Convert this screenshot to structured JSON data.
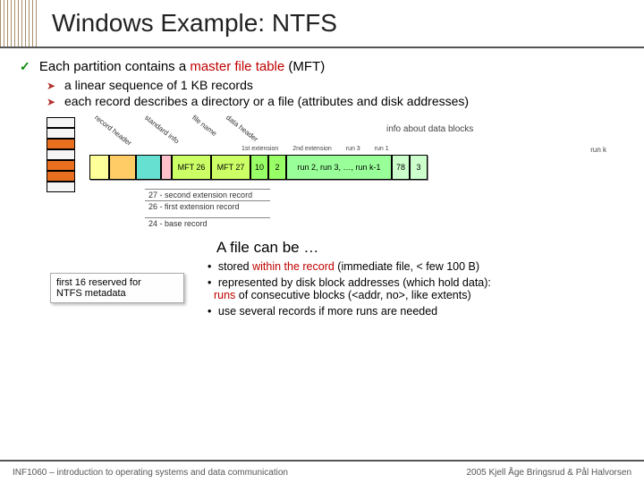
{
  "title": "Windows Example: NTFS",
  "main_bullet": {
    "pre": "Each partition contains a ",
    "red": "master file table",
    "post": " (MFT)"
  },
  "sub_bullets": [
    "a linear sequence of 1 KB records",
    "each record describes a directory or a file (attributes and disk addresses)"
  ],
  "rot_labels": [
    "record header",
    "standard info",
    "file name",
    "data header"
  ],
  "info_label": "info about data blocks",
  "run_header_labels": [
    "1st extension",
    "2nd extension",
    "run 3",
    "run 1"
  ],
  "run_k_label": "run k",
  "record_bar": {
    "mft1": "MFT 26",
    "mft2": "MFT 27",
    "s1": "10",
    "s2": "2",
    "runs": "run 2, run 3, …, run k-1",
    "e1": "78",
    "e2": "3"
  },
  "notes": [
    "27 - second extension record",
    "26 - first extension record",
    "24 - base record"
  ],
  "lower_heading": "A file can be …",
  "lower_bullets": {
    "b1_pre": "stored ",
    "b1_red": "within the record",
    "b1_post": " (immediate file, < few 100 B)",
    "b2_line1": "represented by disk block addresses (which hold data):",
    "b2_line2_red": "runs",
    "b2_line2_post": " of consecutive blocks (<addr, no>, like extents)",
    "b3": "use several records if more runs are needed"
  },
  "metadata_box": {
    "l1": "first 16 reserved for",
    "l2": "NTFS metadata"
  },
  "footer": {
    "left": "INF1060 – introduction to operating systems and data communication",
    "right": "2005  Kjell Åge Bringsrud & Pål Halvorsen"
  }
}
